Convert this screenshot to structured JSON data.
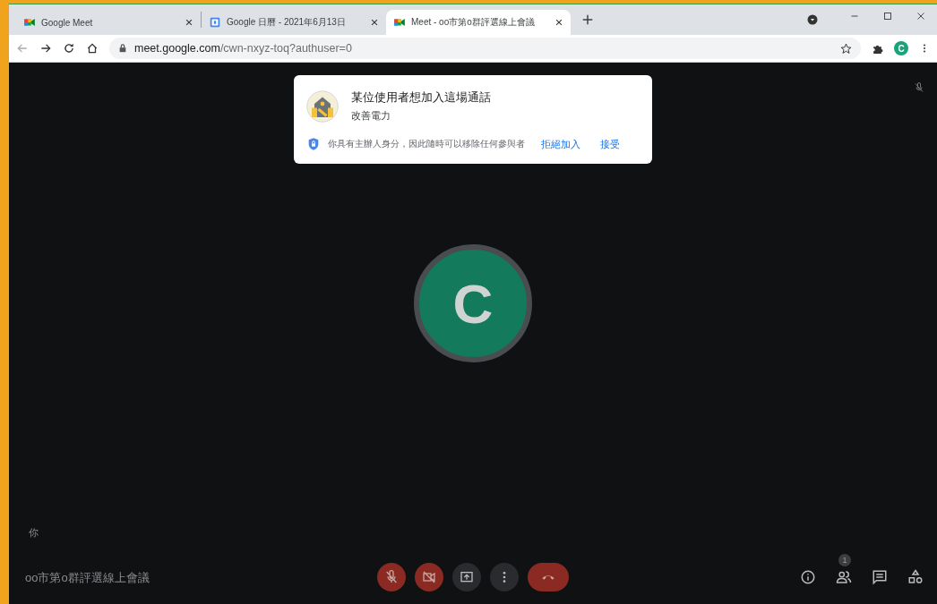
{
  "tabs": [
    {
      "title": "Google Meet",
      "selected": false
    },
    {
      "title": "Google 日曆 - 2021年6月13日",
      "selected": false
    },
    {
      "title": "Meet - oo市第o群評選線上會議",
      "selected": true
    }
  ],
  "address": {
    "host": "meet.google.com",
    "path": "/cwn-nxyz-toq?authuser=0"
  },
  "profile_initial": "C",
  "join_request": {
    "title": "某位使用者想加入這場通話",
    "name": "改善電力",
    "note": "你具有主辦人身分，因此隨時可以移除任何參與者",
    "actions": [
      "拒絕加入",
      "接受"
    ]
  },
  "participant": {
    "initial": "C",
    "muted": true
  },
  "self_label": "你",
  "meeting_title": "oo市第o群評選線上會議",
  "controls": [
    {
      "kind": "mic",
      "on": false
    },
    {
      "kind": "camera",
      "on": false
    },
    {
      "kind": "present"
    },
    {
      "kind": "more"
    },
    {
      "kind": "hangup"
    }
  ],
  "side_controls": [
    {
      "kind": "info"
    },
    {
      "kind": "people",
      "badge": "1"
    },
    {
      "kind": "chat"
    },
    {
      "kind": "activities"
    }
  ]
}
